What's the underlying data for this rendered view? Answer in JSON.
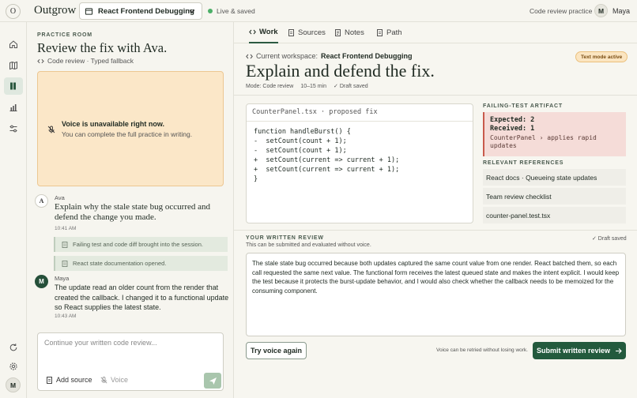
{
  "app": {
    "logo_letter": "O",
    "brand": "Outgrow",
    "workspace_select": "React Frontend Debugging",
    "status": "Live & saved",
    "mode_label": "Code review practice",
    "user_initial": "M",
    "user_name": "Maya"
  },
  "rail": {
    "items": [
      "home-icon",
      "book-icon",
      "practice-icon",
      "chart-icon",
      "sliders-icon"
    ],
    "bottom": [
      "refresh-icon",
      "settings-icon"
    ],
    "avatar_initial": "M"
  },
  "chat": {
    "eyebrow": "PRACTICE ROOM",
    "title": "Review the fix with Ava.",
    "subtitle": "Code review · Typed fallback",
    "voice_notice": {
      "title": "Voice is unavailable right now.",
      "text": "You can complete the full practice in writing."
    },
    "messages": [
      {
        "initial": "A",
        "name": "Ava",
        "text": "Explain why the stale state bug occurred and defend the change you made.",
        "time": "10:41 AM"
      },
      {
        "initial": "M",
        "name": "Maya",
        "text": "The update read an older count from the render that created the callback. I changed it to a functional update so React supplies the latest state.",
        "time": "10:43 AM"
      }
    ],
    "events": [
      "Failing test and code diff brought into the session.",
      "React state documentation opened."
    ],
    "composer": {
      "placeholder": "Continue your written code review...",
      "add_source": "Add source",
      "voice": "Voice"
    }
  },
  "work": {
    "tabs": [
      "Work",
      "Sources",
      "Notes",
      "Path"
    ],
    "current_workspace_label": "Current workspace:",
    "current_workspace": "React Frontend Debugging",
    "badge": "Text mode active",
    "title": "Explain and defend the fix.",
    "meta": [
      "Mode: Code review",
      "10–15 min",
      "✓ Draft saved"
    ],
    "code": {
      "filename": "CounterPanel.tsx · proposed fix",
      "lines": [
        "function handleBurst() {",
        "-  setCount(count + 1);",
        "-  setCount(count + 1);",
        "+  setCount(current => current + 1);",
        "+  setCount(current => current + 1);",
        "}"
      ]
    },
    "artifact": {
      "eyebrow": "FAILING-TEST ARTIFACT",
      "expected": "Expected: 2",
      "received": "Received: 1",
      "detail": "CounterPanel › applies rapid updates"
    },
    "references": {
      "eyebrow": "RELEVANT REFERENCES",
      "items": [
        "React docs · Queueing state updates",
        "Team review checklist",
        "counter-panel.test.tsx"
      ]
    },
    "review": {
      "eyebrow": "YOUR WRITTEN REVIEW",
      "subtitle": "This can be submitted and evaluated without voice.",
      "draft": "✓ Draft saved",
      "text": "The stale state bug occurred because both updates captured the same count value from one render. React batched them, so each call requested the same next value. The functional form receives the latest queued state and makes the intent explicit. I would keep the test because it protects the burst-update behavior, and I would also check whether the callback needs to be memoized for the consuming component.",
      "try_voice": "Try voice again",
      "retry_note": "Voice can be retried without losing work.",
      "submit": "Submit written review"
    }
  },
  "colors": {
    "accent": "#235a3d",
    "warning_bg": "#fbe7c8",
    "error_bg": "#f5dcd8",
    "live": "#4caf68"
  }
}
